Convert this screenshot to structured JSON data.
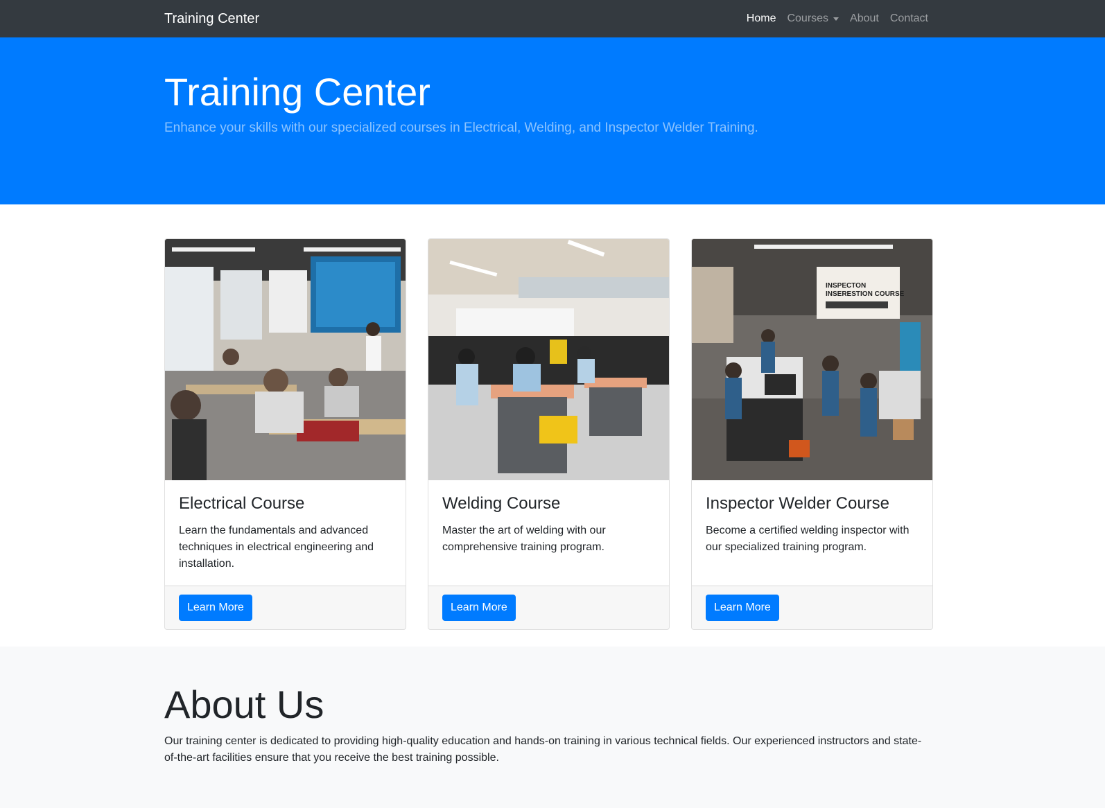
{
  "nav": {
    "brand": "Training Center",
    "links": [
      {
        "label": "Home",
        "active": true
      },
      {
        "label": "Courses",
        "dropdown": true
      },
      {
        "label": "About"
      },
      {
        "label": "Contact"
      }
    ]
  },
  "hero": {
    "title": "Training Center",
    "subtitle": "Enhance your skills with our specialized courses in Electrical, Welding, and Inspector Welder Training."
  },
  "courses": [
    {
      "title": "Electrical Course",
      "text": "Learn the fundamentals and advanced techniques in electrical engineering and installation.",
      "button": "Learn More",
      "image": "electrical-classroom-photo"
    },
    {
      "title": "Welding Course",
      "text": "Master the art of welding with our comprehensive training program.",
      "button": "Learn More",
      "image": "welding-workshop-photo"
    },
    {
      "title": "Inspector Welder Course",
      "text": "Become a certified welding inspector with our specialized training program.",
      "button": "Learn More",
      "image": "inspector-workshop-photo",
      "sign_text": [
        "INSPECTON",
        "INSERESTION COURSE"
      ]
    }
  ],
  "about": {
    "title": "About Us",
    "text": "Our training center is dedicated to providing high-quality education and hands-on training in various technical fields. Our experienced instructors and state-of-the-art facilities ensure that you receive the best training possible."
  },
  "colors": {
    "navbar": "#343a40",
    "primary": "#007bff",
    "about_bg": "#f8f9fa"
  }
}
